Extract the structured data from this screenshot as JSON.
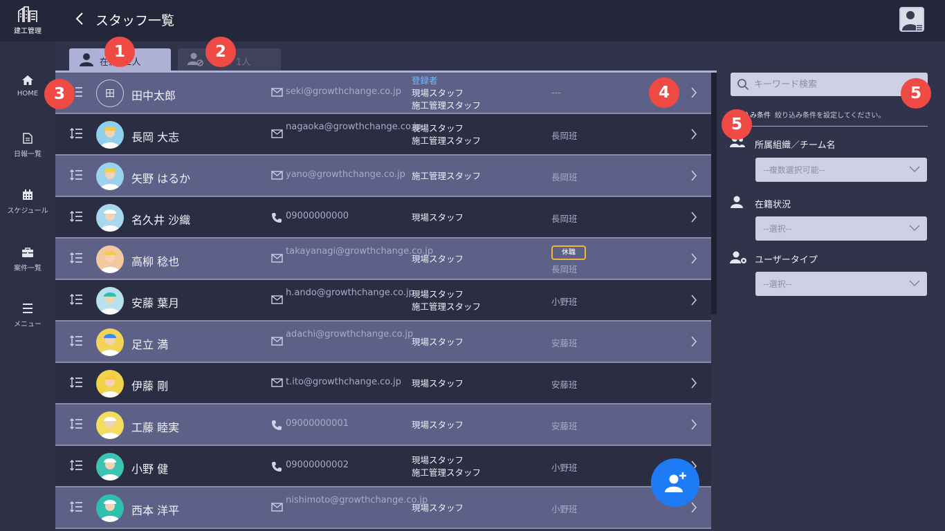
{
  "app": {
    "logo_text": "建工管理"
  },
  "header": {
    "title": "スタッフ一覧"
  },
  "nav": [
    {
      "label": "HOME",
      "icon": "home-icon"
    },
    {
      "label": "日報一覧",
      "icon": "document-icon"
    },
    {
      "label": "スケジュール",
      "icon": "calendar-icon"
    },
    {
      "label": "案件一覧",
      "icon": "briefcase-icon"
    },
    {
      "label": "メニュー",
      "icon": "menu-icon"
    }
  ],
  "tabs": [
    {
      "label": "在籍 12人",
      "icon": "person-icon",
      "active": true
    },
    {
      "label": "1人",
      "icon": "person-blocked-icon",
      "active": false
    }
  ],
  "staff": [
    {
      "initial": "田",
      "name": "田中太郎",
      "contact_type": "email",
      "contact": "seki@growthchange.co.jp",
      "roles_highlight": "登録者",
      "roles": [
        "現場スタッフ",
        "施工管理スタッフ"
      ],
      "team": "---",
      "badge": ""
    },
    {
      "name": "長岡 大志",
      "contact_type": "email",
      "contact": "nagaoka@growthchange.co.jp",
      "roles": [
        "現場スタッフ",
        "施工管理スタッフ"
      ],
      "team": "長岡班",
      "badge": ""
    },
    {
      "name": "矢野 はるか",
      "contact_type": "email",
      "contact": "yano@growthchange.co.jp",
      "roles": [
        "施工管理スタッフ"
      ],
      "team": "長岡班",
      "badge": ""
    },
    {
      "name": "名久井 沙織",
      "contact_type": "phone",
      "contact": "09000000000",
      "roles": [
        "現場スタッフ"
      ],
      "team": "長岡班",
      "badge": ""
    },
    {
      "name": "高柳 稔也",
      "contact_type": "email",
      "contact": "takayanagi@growthchange.co.jp",
      "roles": [
        "現場スタッフ"
      ],
      "team": "長岡班",
      "badge": "休職"
    },
    {
      "name": "安藤 葉月",
      "contact_type": "email",
      "contact": "h.ando@growthchange.co.jp",
      "roles": [
        "現場スタッフ",
        "施工管理スタッフ"
      ],
      "team": "小野班",
      "badge": ""
    },
    {
      "name": "足立 満",
      "contact_type": "email",
      "contact": "adachi@growthchange.co.jp",
      "roles": [
        "現場スタッフ"
      ],
      "team": "安藤班",
      "badge": ""
    },
    {
      "name": "伊藤 剛",
      "contact_type": "email",
      "contact": "t.ito@growthchange.co.jp",
      "roles": [
        "現場スタッフ"
      ],
      "team": "安藤班",
      "badge": ""
    },
    {
      "name": "工藤 睦実",
      "contact_type": "phone",
      "contact": "09000000001",
      "roles": [
        "現場スタッフ"
      ],
      "team": "安藤班",
      "badge": ""
    },
    {
      "name": "小野 健",
      "contact_type": "phone",
      "contact": "09000000002",
      "roles": [
        "現場スタッフ",
        "施工管理スタッフ"
      ],
      "team": "小野班",
      "badge": ""
    },
    {
      "name": "西本 洋平",
      "contact_type": "email",
      "contact": "nishimoto@growthchange.co.jp",
      "roles": [
        "現場スタッフ"
      ],
      "team": "小野班",
      "badge": ""
    }
  ],
  "filter": {
    "search_placeholder": "キーワード検索",
    "cond_label": "込み条件",
    "cond_hint": "絞り込み条件を設定してください。",
    "fields": [
      {
        "label": "所属組織／チーム名",
        "value": "--複数選択可能--",
        "icon": "group-icon"
      },
      {
        "label": "在籍状況",
        "value": "--選択--",
        "icon": "person-icon"
      },
      {
        "label": "ユーザータイプ",
        "value": "--選択--",
        "icon": "person-gear-icon"
      }
    ]
  },
  "callouts": [
    "1",
    "2",
    "3",
    "4",
    "5",
    "5"
  ],
  "colors": {
    "accent": "#1d7cf5",
    "callout": "#f04a45",
    "badge_border": "#f3b53a",
    "highlight_role": "#6fb8ff"
  }
}
